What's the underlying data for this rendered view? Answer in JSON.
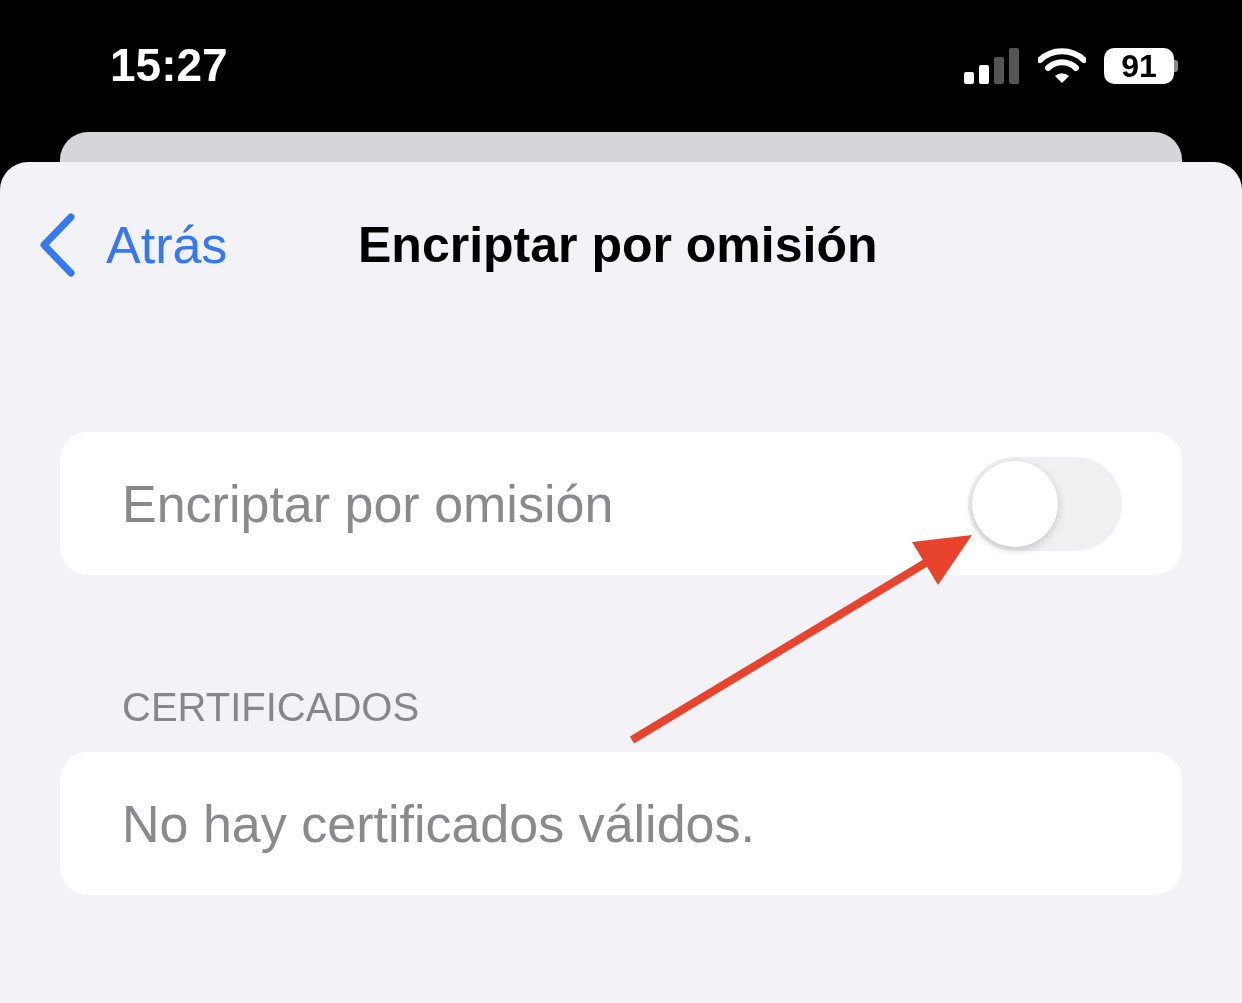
{
  "status_bar": {
    "time": "15:27",
    "battery": "91"
  },
  "nav": {
    "back": "Atrás",
    "title": "Encriptar por omisión"
  },
  "settings": [
    {
      "kind": "toggle",
      "label": "Encriptar por omisión",
      "on": false,
      "disabled": true
    }
  ],
  "certificates": {
    "header": "CERTIFICADOS",
    "message": "No hay certificados válidos."
  }
}
